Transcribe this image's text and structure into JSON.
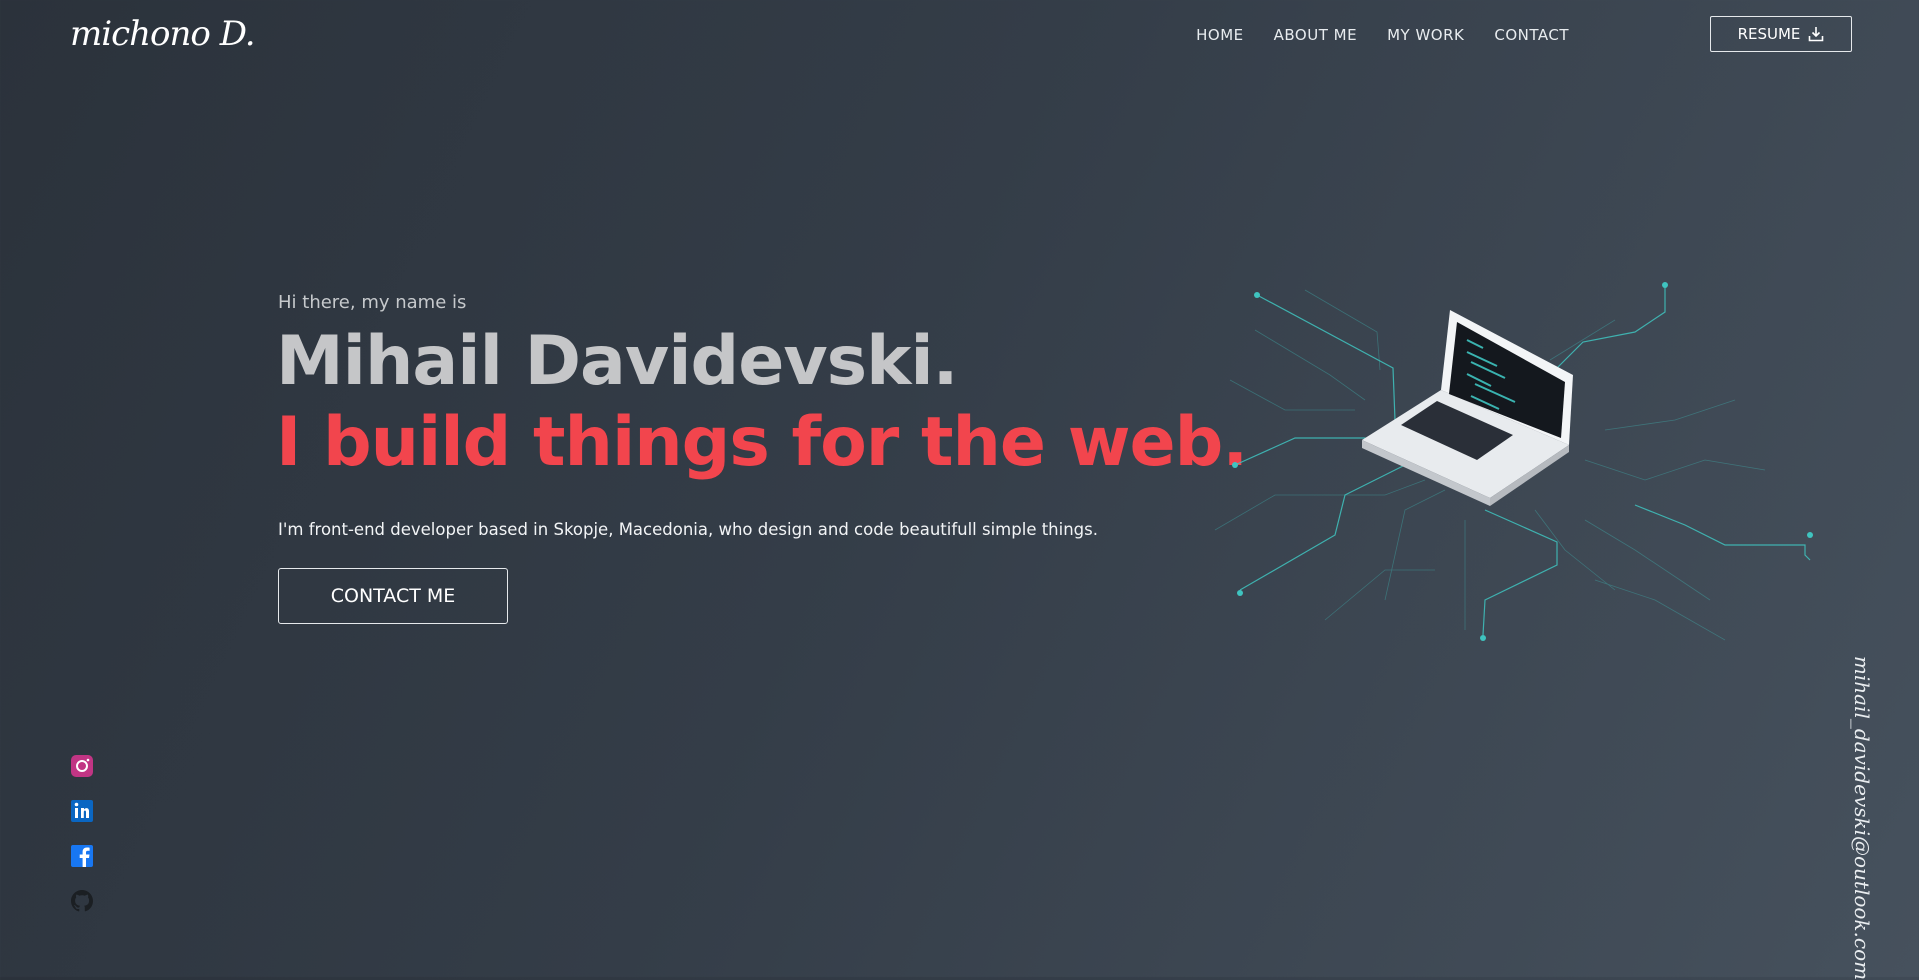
{
  "header": {
    "logo": "michono D.",
    "nav": [
      "HOME",
      "ABOUT ME",
      "MY WORK",
      "CONTACT"
    ],
    "resume_label": "RESUME"
  },
  "hero": {
    "intro": "Hi there, my name is",
    "name": "Mihail Davidevski.",
    "tagline": "I build things for the web.",
    "description": "I'm front-end developer based in Skopje, Macedonia, who design and code beautifull simple things.",
    "cta_label": "CONTACT ME"
  },
  "social": [
    "instagram-icon",
    "linkedin-icon",
    "facebook-icon",
    "github-icon"
  ],
  "email": "mihail_davidevski@outlook.com",
  "colors": {
    "accent": "#f2454d",
    "circuit": "#3fc4c0",
    "instagram": "#c13584",
    "linkedin": "#0a66c2",
    "facebook": "#1877f2",
    "github": "#1b1f23"
  }
}
